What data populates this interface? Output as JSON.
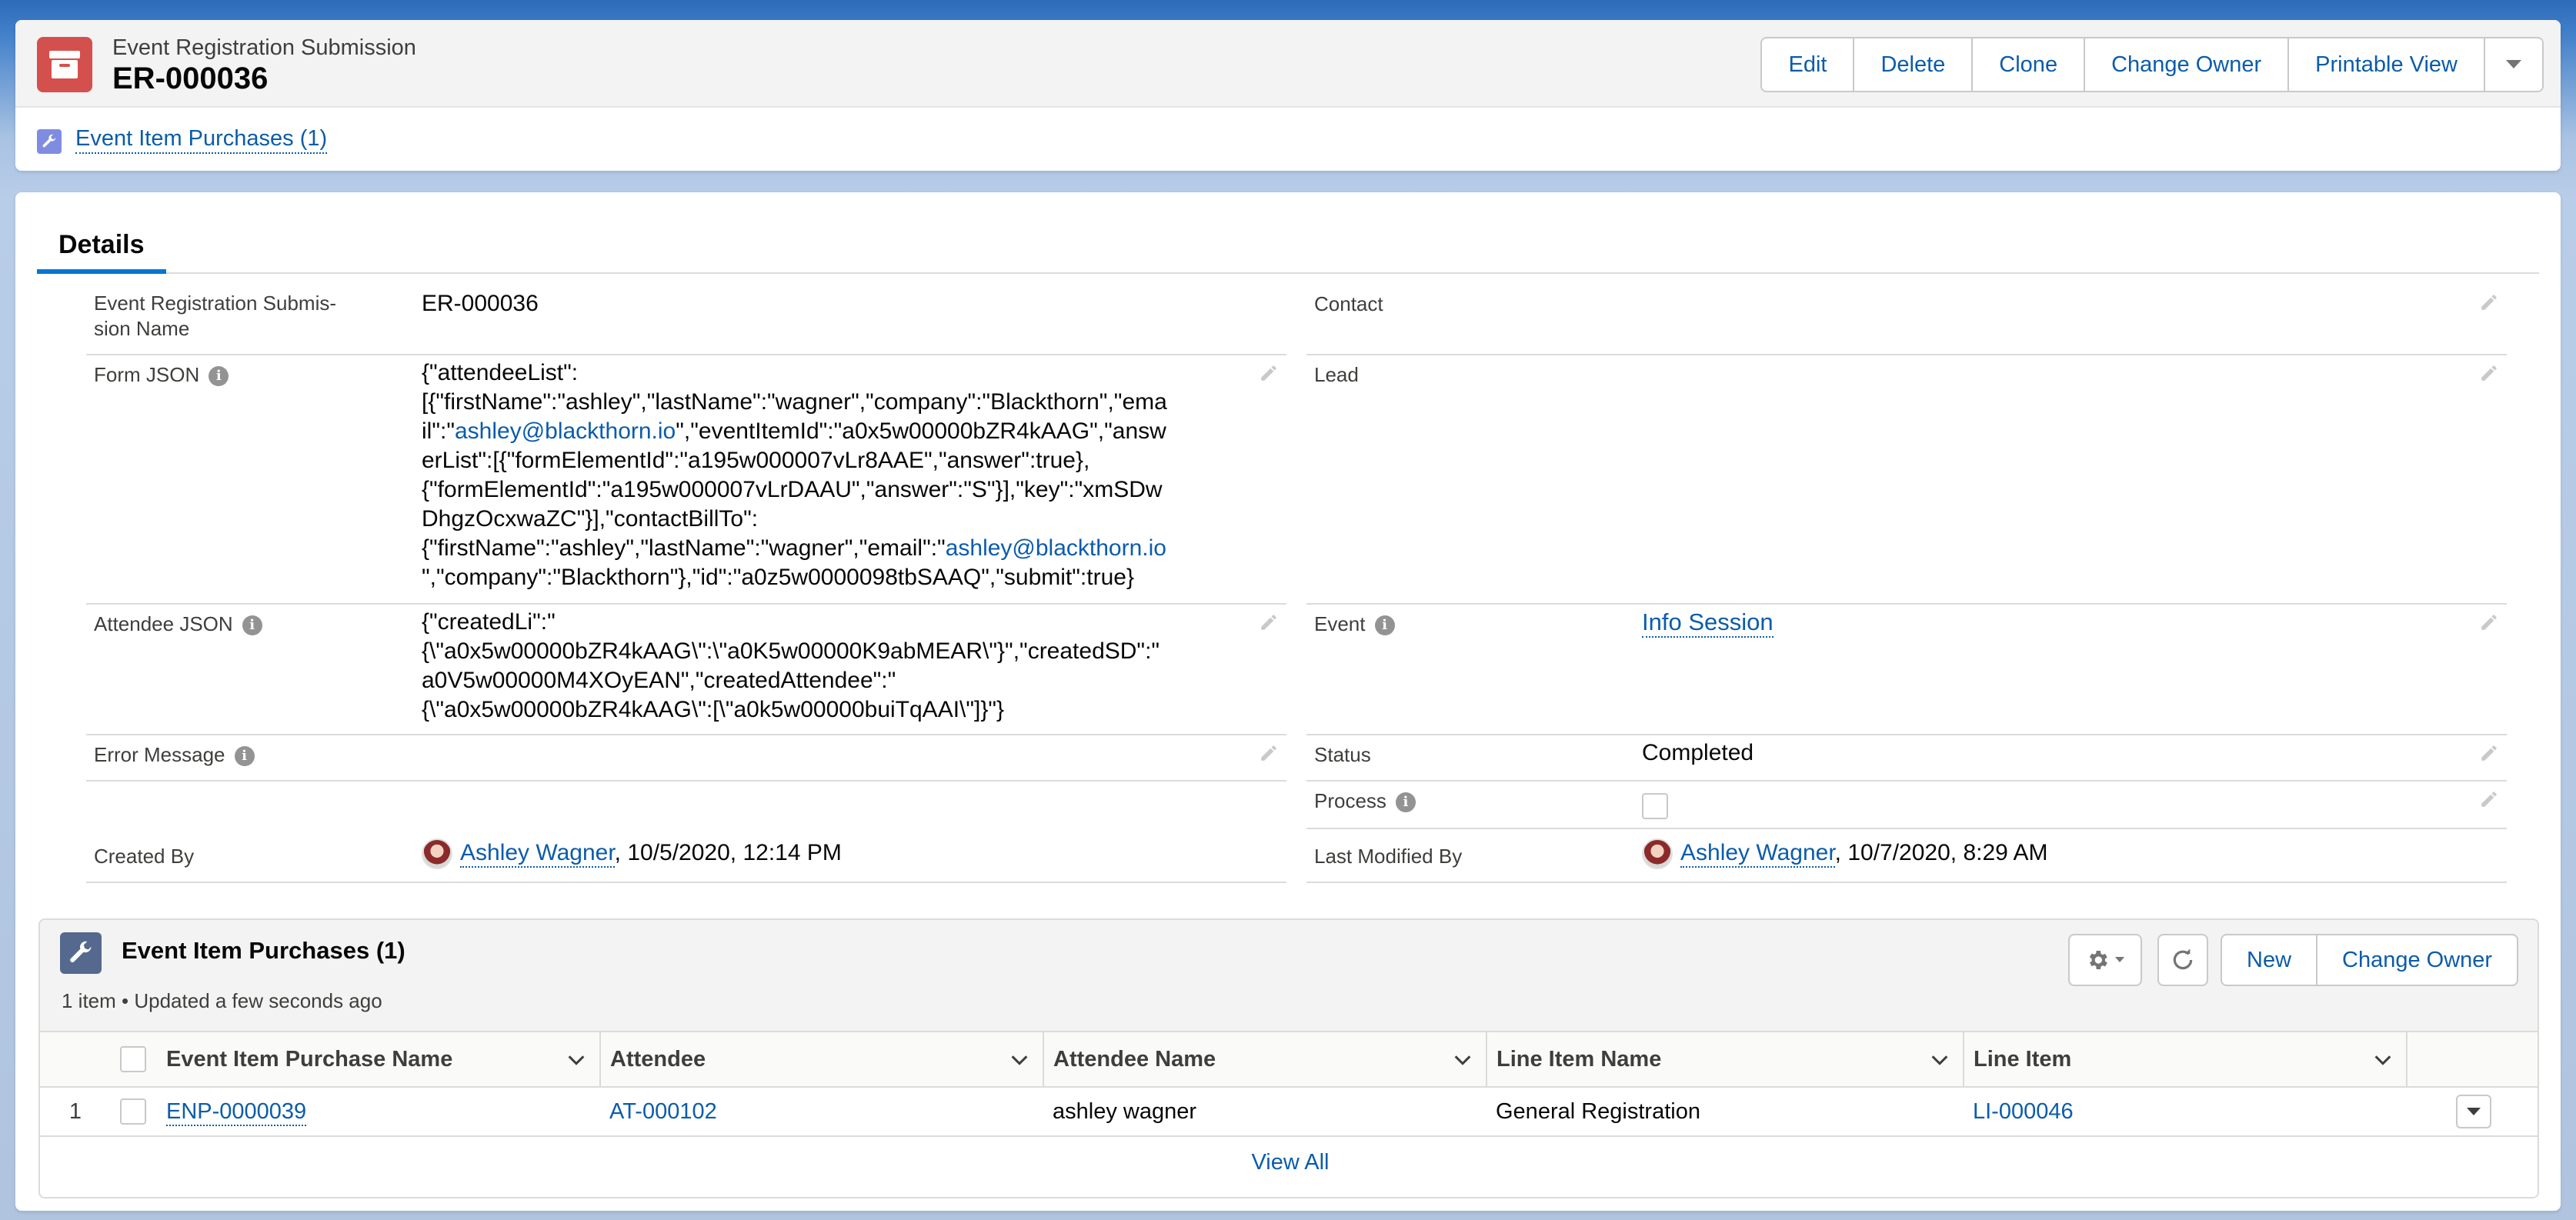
{
  "header": {
    "object_type": "Event Registration Submission",
    "record_name": "ER-000036",
    "buttons": [
      "Edit",
      "Delete",
      "Clone",
      "Change Owner",
      "Printable View"
    ],
    "related_link": "Event Item Purchases (1)"
  },
  "tabs": {
    "active": "Details"
  },
  "fields": {
    "name_label": "Event Registration Submis-\nsion Name",
    "name_value": "ER-000036",
    "contact_label": "Contact",
    "lead_label": "Lead",
    "form_json_label": "Form JSON",
    "form_json_parts": [
      "{\"attendeeList\":\n[{\"firstName\":\"ashley\",\"lastName\":\"wagner\",\"company\":\"Blackthorn\",\"ema\nil\":\"",
      "ashley@blackthorn.io",
      "\",\"eventItemId\":\"a0x5w00000bZR4kAAG\",\"answ\nerList\":[{\"formElementId\":\"a195w000007vLr8AAE\",\"answer\":true},\n{\"formElementId\":\"a195w000007vLrDAAU\",\"answer\":\"S\"}],\"key\":\"xmSDw\nDhgzOcxwaZC\"}],\"contactBillTo\":\n{\"firstName\":\"ashley\",\"lastName\":\"wagner\",\"email\":\"",
      "ashley@blackthorn.io",
      "\n\",\"company\":\"Blackthorn\"},\"id\":\"a0z5w0000098tbSAAQ\",\"submit\":true}"
    ],
    "attendee_json_label": "Attendee JSON",
    "attendee_json_value": "{\"createdLi\":\"\n{\\\"a0x5w00000bZR4kAAG\\\":\\\"a0K5w00000K9abMEAR\\\"}\",\"createdSD\":\"\na0V5w00000M4XOyEAN\",\"createdAttendee\":\"\n{\\\"a0x5w00000bZR4kAAG\\\":[\\\"a0k5w00000buiTqAAI\\\"]}\"}",
    "event_label": "Event",
    "event_value": "Info Session",
    "error_label": "Error Message",
    "status_label": "Status",
    "status_value": "Completed",
    "process_label": "Process",
    "created_by_label": "Created By",
    "created_by_user": "Ashley Wagner",
    "created_by_date": ", 10/5/2020, 12:14 PM",
    "modified_by_label": "Last Modified By",
    "modified_by_user": "Ashley Wagner",
    "modified_by_date": ", 10/7/2020, 8:29 AM"
  },
  "related_list": {
    "title": "Event Item Purchases (1)",
    "subtitle": "1 item • Updated a few seconds ago",
    "buttons": [
      "New",
      "Change Owner"
    ],
    "columns": [
      "Event Item Purchase Name",
      "Attendee",
      "Attendee Name",
      "Line Item Name",
      "Line Item"
    ],
    "rows": [
      {
        "num": "1",
        "name": "ENP-0000039",
        "attendee": "AT-000102",
        "attendee_name": "ashley wagner",
        "line_item_name": "General Registration",
        "line_item": "LI-000046"
      }
    ],
    "view_all": "View All"
  }
}
